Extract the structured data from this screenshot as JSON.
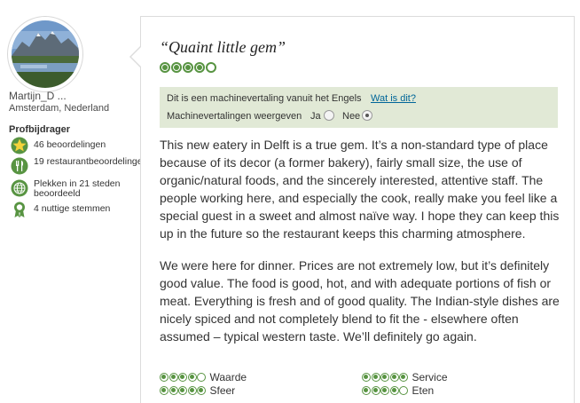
{
  "profile": {
    "username": "Martijn_D ...",
    "location": "Amsterdam, Nederland",
    "level": "Profbijdrager",
    "stats": [
      {
        "icon": "star-badge-icon",
        "text": "46 beoordelingen"
      },
      {
        "icon": "fork-knife-icon",
        "text": "19 restaurantbeoordelingen"
      },
      {
        "icon": "globe-icon",
        "text": "Plekken in 21 steden beoordeeld"
      },
      {
        "icon": "ribbon-icon",
        "text": "4 nuttige stemmen"
      }
    ]
  },
  "review": {
    "title": "“Quaint little gem”",
    "rating": 5,
    "machine_translation": {
      "notice": "Dit is een machinevertaling vanuit het Engels",
      "link": "Wat is dit?",
      "toggle_label": "Machinevertalingen weergeven",
      "option_yes": "Ja",
      "option_no": "Nee",
      "selected": "Nee"
    },
    "paragraphs": [
      "This new eatery in Delft is a true gem. It’s a non-standard type of place because of its decor (a former bakery), fairly small size, the use of organic/natural foods, and the sincerely interested, attentive staff. The people working here, and especially the cook, really make you feel like a special guest in a sweet and almost naïve way. I hope they can keep this up in the future so the restaurant keeps this charming atmosphere.",
      "We were here for dinner. Prices are not extremely low, but it’s definitely good value. The food is good, hot, and with adequate portions of fish or meat. Everything is fresh and of good quality. The Indian-style dishes are nicely spiced and not completely blend to fit the - elsewhere often assumed – typical western taste. We’ll definitely go again."
    ],
    "sub_ratings": [
      {
        "label": "Waarde",
        "rating": 4
      },
      {
        "label": "Service",
        "rating": 5
      },
      {
        "label": "Sfeer",
        "rating": 5
      },
      {
        "label": "Eten",
        "rating": 4
      }
    ]
  },
  "colors": {
    "bubble_green": "#589442",
    "mt_background": "#e1e9d6",
    "link_blue": "#006699"
  }
}
